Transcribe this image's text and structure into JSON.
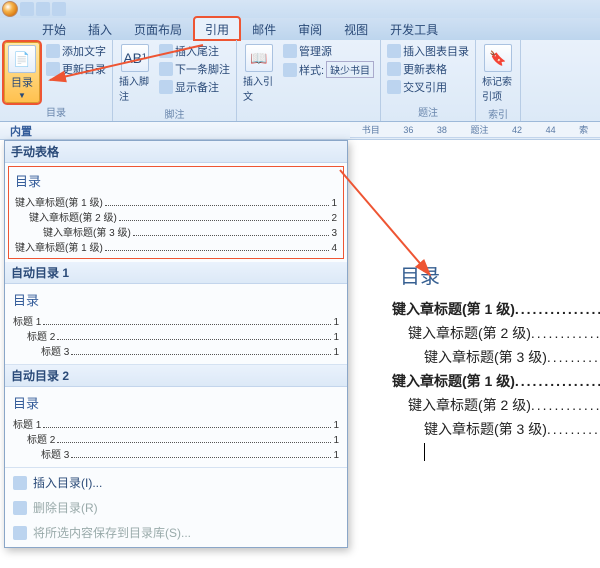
{
  "tabs": [
    "开始",
    "插入",
    "页面布局",
    "引用",
    "邮件",
    "审阅",
    "视图",
    "开发工具"
  ],
  "active_tab_index": 3,
  "ribbon": {
    "toc": {
      "label": "目录"
    },
    "addtext": "添加文字",
    "update_toc": "更新目录",
    "group_toc": "目录",
    "insert_footnote": "插入脚注",
    "fn_ab": "AB¹",
    "insert_endnote": "插入尾注",
    "next_footnote": "下一条脚注",
    "show_notes": "显示备注",
    "group_fn": "脚注",
    "insert_citation": "插入引文",
    "manage_sources": "管理源",
    "style": "样式:",
    "missing": "缺少书目",
    "insert_figtable": "插入图表目录",
    "update_table2": "更新表格",
    "crossref": "交叉引用",
    "mark_entry": "标记索引项",
    "group_caption": "题注",
    "group_index": "索引"
  },
  "substrip": {
    "a": "内置",
    "b": "书目"
  },
  "gallery": {
    "manual_hdr": "手动表格",
    "preview_title": "目录",
    "lv1": "键入章标题(第 1 级)",
    "lv2": "键入章标题(第 2 级)",
    "lv3": "键入章标题(第 3 级)",
    "lv1b": "键入章标题(第 1 级)",
    "p1": "1",
    "p2": "2",
    "p3": "3",
    "p4": "4",
    "auto1_hdr": "自动目录 1",
    "auto2_hdr": "自动目录 2",
    "a_title": "目录",
    "a_h1": "标题 1",
    "a_h2": "标题 2",
    "a_h3": "标题 3",
    "ap": "1",
    "insert_toc": "插入目录(I)...",
    "remove_toc": "删除目录(R)",
    "save_sel": "将所选内容保存到目录库(S)..."
  },
  "doc": {
    "title": "目录",
    "l1a": "键入章标题(第 1 级)",
    "l2a": "键入章标题(第 2 级)",
    "l3a": "键入章标题(第 3 级)",
    "l1b": "键入章标题(第 1 级)",
    "l2b": "键入章标题(第 2 级)",
    "l3b": "键入章标题(第 3 级)",
    "dots": ".................."
  },
  "ruler": [
    "书目",
    "36",
    "38",
    "题注",
    "42",
    "44",
    "索"
  ]
}
